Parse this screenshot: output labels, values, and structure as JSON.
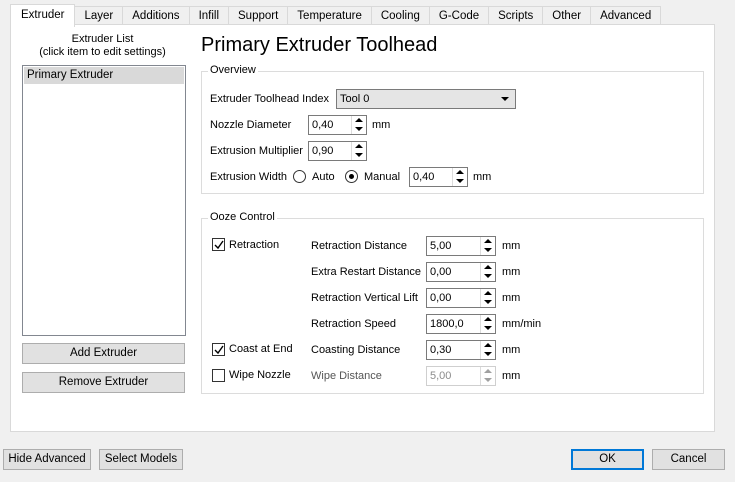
{
  "tabs": [
    "Extruder",
    "Layer",
    "Additions",
    "Infill",
    "Support",
    "Temperature",
    "Cooling",
    "G-Code",
    "Scripts",
    "Other",
    "Advanced"
  ],
  "sidebar": {
    "title_line1": "Extruder List",
    "title_line2": "(click item to edit settings)",
    "items": [
      "Primary Extruder"
    ],
    "add_button": "Add Extruder",
    "remove_button": "Remove Extruder"
  },
  "main": {
    "title": "Primary Extruder Toolhead"
  },
  "overview": {
    "title": "Overview",
    "toolhead_index_label": "Extruder Toolhead Index",
    "toolhead_index_value": "Tool 0",
    "nozzle_label": "Nozzle Diameter",
    "nozzle_value": "0,40",
    "nozzle_unit": "mm",
    "multiplier_label": "Extrusion Multiplier",
    "multiplier_value": "0,90",
    "width_label": "Extrusion Width",
    "width_auto": "Auto",
    "width_manual": "Manual",
    "width_mode": "Manual",
    "width_value": "0,40",
    "width_unit": "mm"
  },
  "ooze": {
    "title": "Ooze Control",
    "retraction_check": "Retraction",
    "retraction_checked": true,
    "coast_check": "Coast at End",
    "coast_checked": true,
    "wipe_check": "Wipe Nozzle",
    "wipe_checked": false,
    "fields": [
      {
        "label": "Retraction Distance",
        "value": "5,00",
        "unit": "mm",
        "disabled": false
      },
      {
        "label": "Extra Restart Distance",
        "value": "0,00",
        "unit": "mm",
        "disabled": false
      },
      {
        "label": "Retraction Vertical Lift",
        "value": "0,00",
        "unit": "mm",
        "disabled": false
      },
      {
        "label": "Retraction Speed",
        "value": "1800,0",
        "unit": "mm/min",
        "disabled": false
      },
      {
        "label": "Coasting Distance",
        "value": "0,30",
        "unit": "mm",
        "disabled": false
      },
      {
        "label": "Wipe Distance",
        "value": "5,00",
        "unit": "mm",
        "disabled": true
      }
    ]
  },
  "footer": {
    "hide_advanced": "Hide Advanced",
    "select_models": "Select Models",
    "ok": "OK",
    "cancel": "Cancel"
  }
}
